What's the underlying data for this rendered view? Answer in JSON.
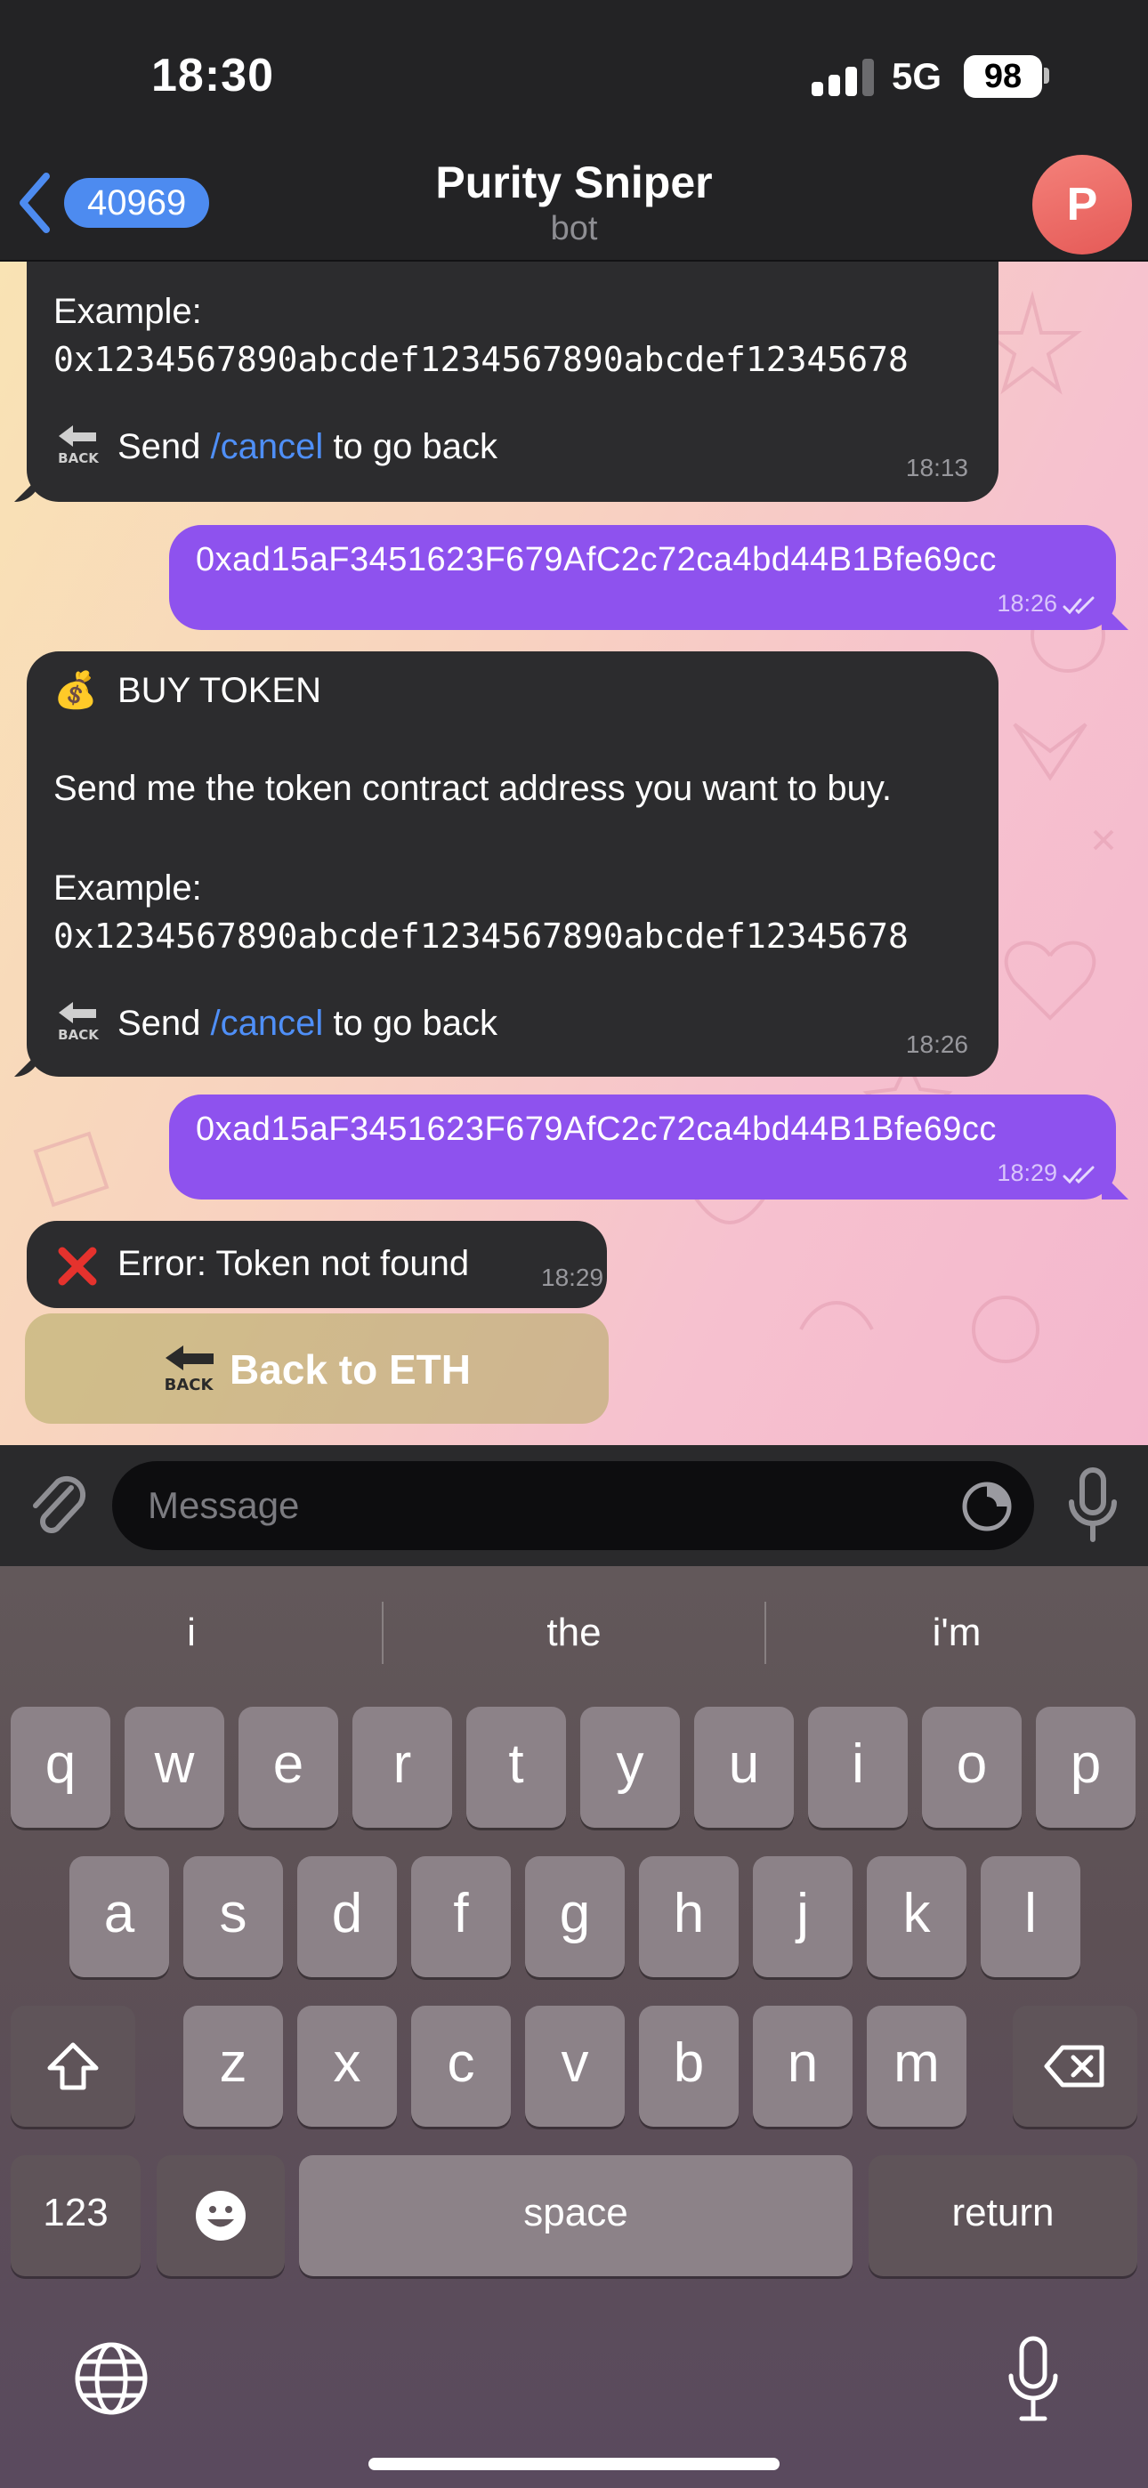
{
  "status_bar": {
    "time": "18:30",
    "network": "5G",
    "battery": "98"
  },
  "header": {
    "back_count": "40969",
    "title": "Purity Sniper",
    "subtitle": "bot",
    "avatar_letter": "P"
  },
  "messages": {
    "m1": {
      "example_label": "Example:",
      "example_address": "0x1234567890abcdef1234567890abcdef12345678",
      "cancel_prefix": "Send",
      "cancel_command": "/cancel",
      "cancel_suffix": "to go back",
      "time": "18:13"
    },
    "m2": {
      "text": "0xad15aF3451623F679AfC2c72ca4bd44B1Bfe69cc",
      "time": "18:26"
    },
    "m3": {
      "heading_emoji": "💰",
      "heading": "BUY TOKEN",
      "body": "Send me the token contract address you want to buy.",
      "example_label": "Example:",
      "example_address": "0x1234567890abcdef1234567890abcdef12345678",
      "cancel_prefix": "Send",
      "cancel_command": "/cancel",
      "cancel_suffix": "to go back",
      "time": "18:26"
    },
    "m4": {
      "text": "0xad15aF3451623F679AfC2c72ca4bd44B1Bfe69cc",
      "time": "18:29"
    },
    "m5": {
      "text": "Error: Token not found",
      "time": "18:29"
    }
  },
  "inline_button": {
    "label": "Back to ETH",
    "icon": "back-arrow-icon"
  },
  "input": {
    "placeholder": "Message"
  },
  "keyboard": {
    "suggestions": [
      "i",
      "the",
      "i'm"
    ],
    "row1": [
      "q",
      "w",
      "e",
      "r",
      "t",
      "y",
      "u",
      "i",
      "o",
      "p"
    ],
    "row2": [
      "a",
      "s",
      "d",
      "f",
      "g",
      "h",
      "j",
      "k",
      "l"
    ],
    "row3": [
      "z",
      "x",
      "c",
      "v",
      "b",
      "n",
      "m"
    ],
    "numbers": "123",
    "space": "space",
    "return": "return"
  },
  "colors": {
    "incoming_bubble": "#2c2c2e",
    "outgoing_bubble": "#8e52ee",
    "link": "#4f8ff7",
    "badge": "#4d8bf0",
    "avatar": "#e55a57"
  }
}
